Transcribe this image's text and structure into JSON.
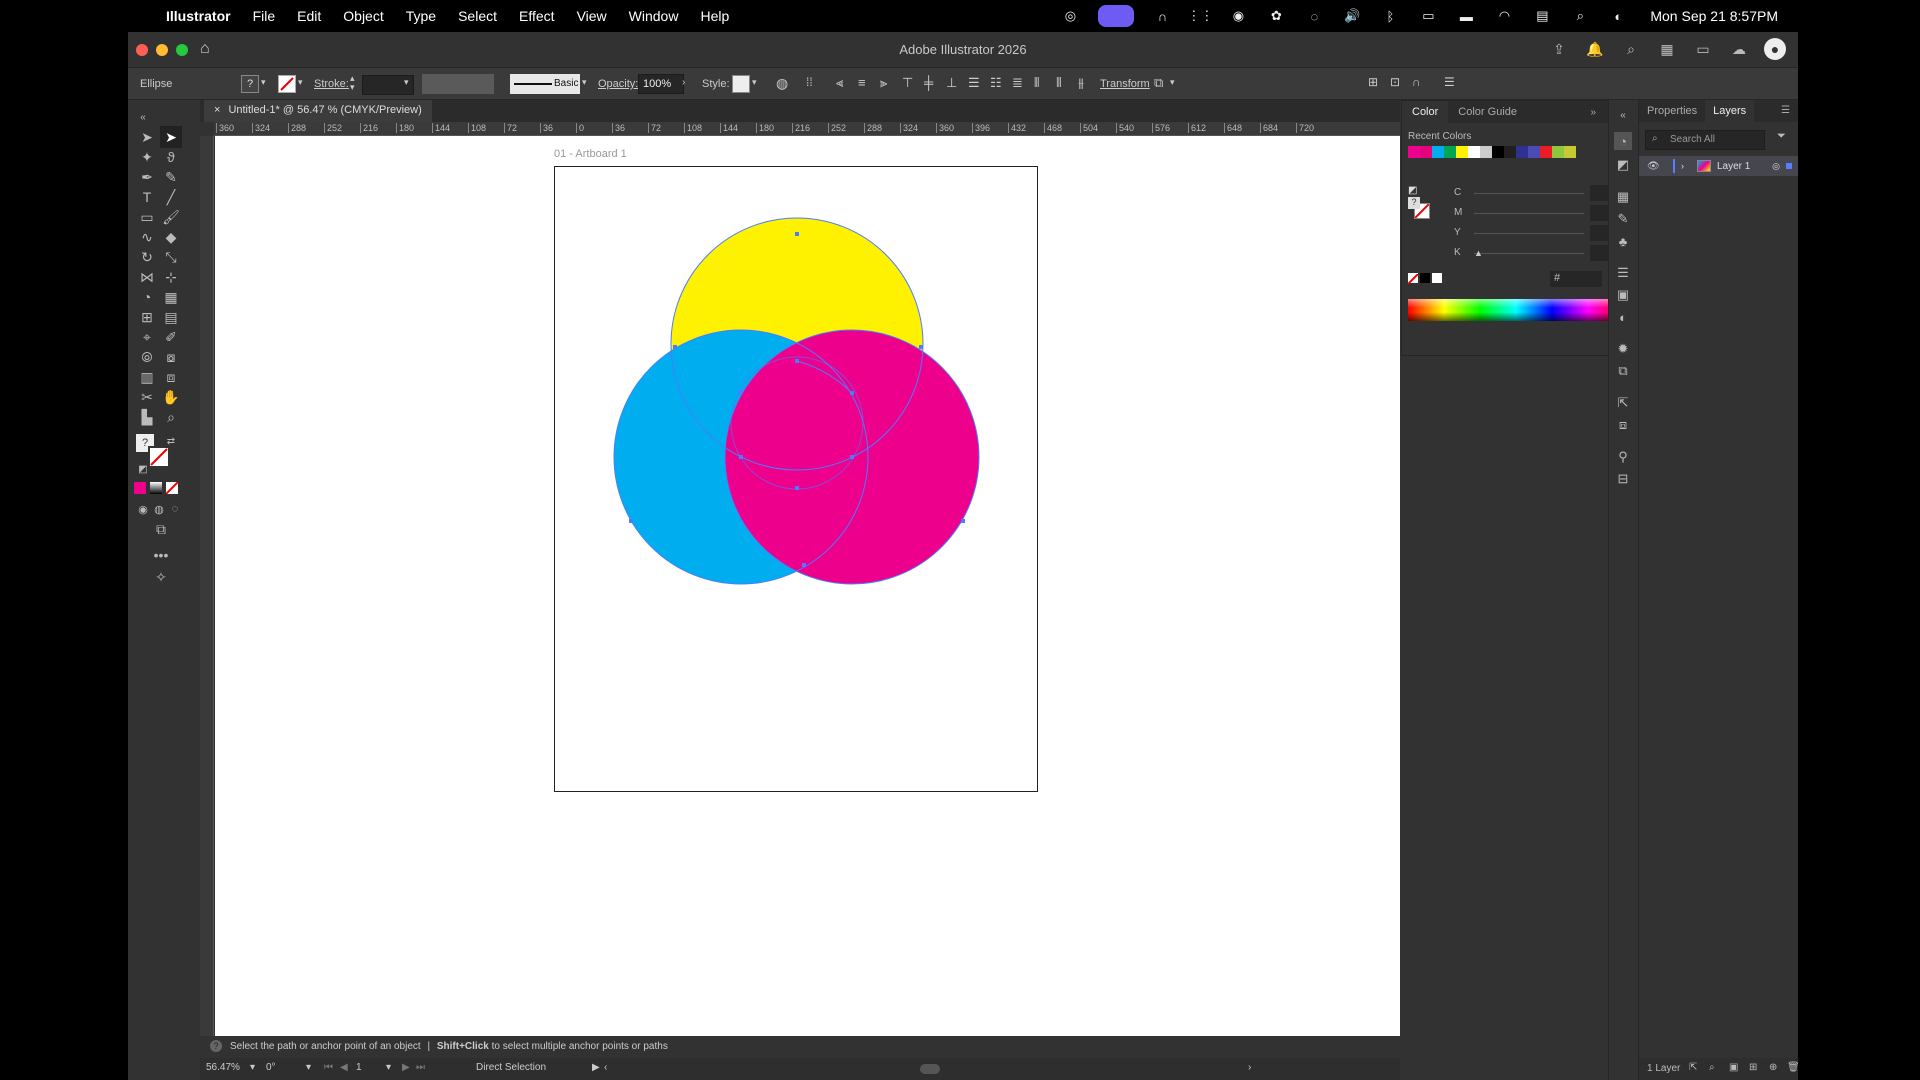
{
  "menubar": {
    "app": "Illustrator",
    "items": [
      "File",
      "Edit",
      "Object",
      "Type",
      "Select",
      "Effect",
      "View",
      "Window",
      "Help"
    ],
    "clock": "Mon Sep 21  8:57PM"
  },
  "window": {
    "title": "Adobe Illustrator 2026"
  },
  "control_bar": {
    "selection_label": "Ellipse",
    "stroke_label": "Stroke:",
    "brush_label": "Basic",
    "opacity_label": "Opacity:",
    "opacity_value": "100%",
    "style_label": "Style:",
    "transform_label": "Transform"
  },
  "document_tab": {
    "close": "×",
    "title": "Untitled-1* @ 56.47 % (CMYK/Preview)"
  },
  "ruler": {
    "h_ticks": [
      "360",
      "324",
      "288",
      "252",
      "216",
      "180",
      "144",
      "108",
      "72",
      "36",
      "0",
      "36",
      "72",
      "108",
      "144",
      "180",
      "216",
      "252",
      "288",
      "324",
      "360",
      "396",
      "432",
      "468",
      "504",
      "540",
      "576",
      "612",
      "648",
      "684",
      "720"
    ]
  },
  "artboard": {
    "label": "01 - Artboard 1",
    "circles": [
      {
        "name": "yellow",
        "color": "#fff200"
      },
      {
        "name": "cyan",
        "color": "#00aeef"
      },
      {
        "name": "magenta",
        "color": "#ec008c"
      }
    ],
    "selection_color": "#4a7cff"
  },
  "color_panel": {
    "tabs": [
      "Color",
      "Color Guide"
    ],
    "recent_label": "Recent Colors",
    "recent_colors": [
      "#ec008c",
      "#e6007e",
      "#00aeef",
      "#00a651",
      "#fff200",
      "#ffffff",
      "#cccccc",
      "#000000",
      "#231f20",
      "#2e3192",
      "#4b4bb5",
      "#ed1c24",
      "#8dc63f",
      "#c8c832"
    ],
    "cmyk": [
      {
        "label": "C",
        "value": "",
        "unit": "%"
      },
      {
        "label": "M",
        "value": "",
        "unit": "%"
      },
      {
        "label": "Y",
        "value": "",
        "unit": "%"
      },
      {
        "label": "K",
        "value": "0",
        "unit": "%"
      }
    ],
    "hex_label": "#"
  },
  "right_panel": {
    "tabs": [
      "Properties",
      "Layers"
    ],
    "search_placeholder": "Search All",
    "layer_name": "Layer 1",
    "footer_count": "1 Layer"
  },
  "status_bar": {
    "hint_text": "Select the path or anchor point of an object",
    "separator": "|",
    "hint_key": "Shift+Click",
    "hint_rest": "to select multiple anchor points or paths"
  },
  "bottom_bar": {
    "zoom": "56.47%",
    "rotation": "0°",
    "artboard_number": "1",
    "tool_name": "Direct Selection"
  }
}
